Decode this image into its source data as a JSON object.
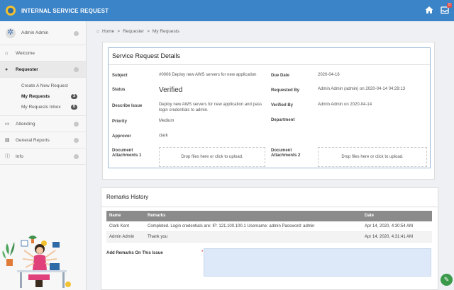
{
  "app": {
    "title": "INTERNAL SERVICE REQUEST"
  },
  "topbar": {
    "home_icon": "home-icon",
    "inbox_icon": "inbox-icon",
    "inbox_badge": "0"
  },
  "sidebar": {
    "user": "Admin Admin",
    "items": [
      {
        "label": "Welcome",
        "icon": "home-icon"
      },
      {
        "label": "Requester",
        "icon": "user-icon"
      },
      {
        "label": "Attending",
        "icon": "inbox-icon"
      },
      {
        "label": "General Reports",
        "icon": "report-icon"
      },
      {
        "label": "Info",
        "icon": "info-icon"
      }
    ],
    "requester_sub": [
      {
        "label": "Create A New Request",
        "count": ""
      },
      {
        "label": "My Requests",
        "count": "3"
      },
      {
        "label": "My Requests Inbox",
        "count": "0"
      }
    ]
  },
  "breadcrumb": {
    "home": "Home",
    "sep": ">",
    "b1": "Requester",
    "b2": "My Requests"
  },
  "details": {
    "title": "Service Request Details",
    "subject_label": "Subject",
    "subject": "#0006  Deploy new AWS servers for new application",
    "due_label": "Due Date",
    "due": "2020-04-16",
    "status_label": "Status",
    "status": "Verified",
    "requested_by_label": "Requested By",
    "requested_by": "Admin Admin (admin) on 2020-04-14 04:29:13",
    "describe_label": "Describe Issue",
    "describe": "Deploy new AWS servers for new application and pass login credentials to admin.",
    "verified_by_label": "Verified By",
    "verified_by": "Admin Admin on 2020-04-14",
    "priority_label": "Priority",
    "priority": "Medium",
    "department_label": "Department",
    "department": "",
    "approver_label": "Approver",
    "approver": "clark",
    "doc1_label": "Document Attachments 1",
    "doc2_label": "Document Attachments 2",
    "drop_text": "Drop files here or click to upload."
  },
  "remarks": {
    "title": "Remarks History",
    "columns": [
      "Name",
      "Remarks",
      "Date"
    ],
    "rows": [
      {
        "name": "Clark Kent",
        "remarks": "Completed. Login credentials are: IP: 121.100.100.1 Username: admin Password: admin",
        "date": "Apr 14, 2020, 4:30:54 AM"
      },
      {
        "name": "Admin Admin",
        "remarks": "Thank you",
        "date": "Apr 14, 2020, 4:31:41 AM"
      }
    ],
    "add_label": "Add Remarks On This Issue",
    "required_mark": "*",
    "input_value": ""
  }
}
